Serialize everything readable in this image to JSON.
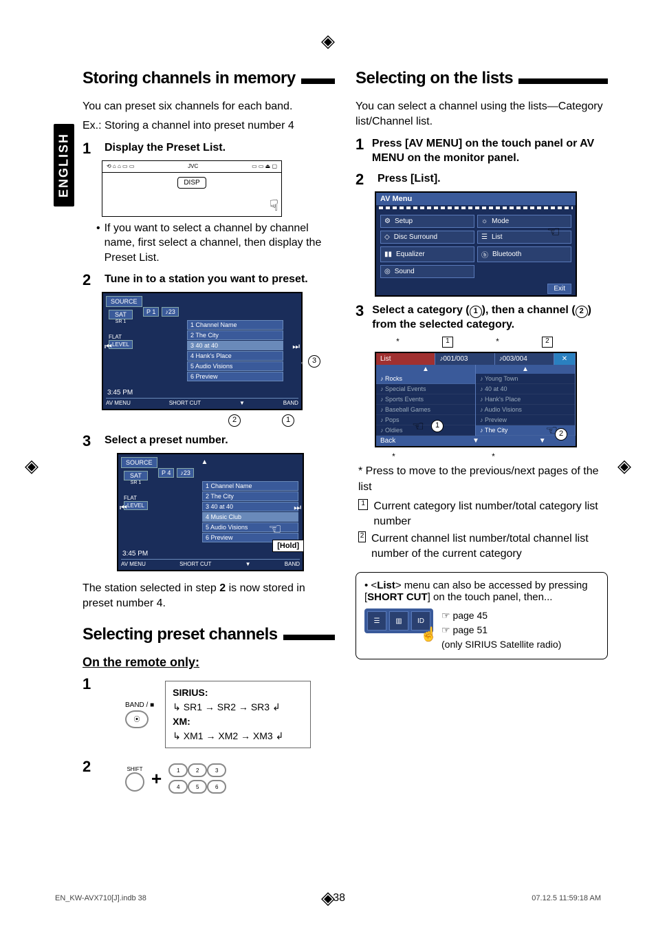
{
  "side_label": "ENGLISH",
  "page_number": "38",
  "footer_left": "EN_KW-AVX710[J].indb   38",
  "footer_right": "07.12.5   11:59:18 AM",
  "left": {
    "section1_title": "Storing channels in memory",
    "intro1": "You can preset six channels for each band.",
    "intro2": "Ex.: Storing a channel into preset number 4",
    "step1_num": "1",
    "step1_text": "Display the Preset List.",
    "disp_label": "DISP",
    "topstrip_brand": "JVC",
    "bullet1": "If you want to select a channel by channel name, first select a channel, then display the Preset List.",
    "step2_num": "2",
    "step2_text": "Tune in to a station you want to preset.",
    "screen_source": "SOURCE",
    "screen_sat": "SAT",
    "screen_sr": "SR 1",
    "screen_p1": "P 1",
    "screen_ch": "23",
    "screen_flat": "FLAT",
    "screen_level": "LEVEL",
    "plist": [
      "1 Channel Name",
      "2 The City",
      "3 40 at 40",
      "4 Hank's Place",
      "5 Audio Visions",
      "6 Preview"
    ],
    "screen_time": "3:45 PM",
    "screen_btm_left": "AV MENU",
    "screen_btm_short": "SHORT CUT",
    "screen_btm_right": "BAND",
    "step3_num": "3",
    "step3_text": "Select a preset number.",
    "screen2_p": "P 4",
    "plist2": [
      "1 Channel Name",
      "2 The City",
      "3 40 at 40",
      "4 Music Club",
      "5 Audio Visions",
      "6 Preview"
    ],
    "hold_label": "[Hold]",
    "after_text_a": "The station selected in step ",
    "after_text_b": " is now stored in preset number 4.",
    "after_step_ref": "2",
    "section2_title": "Selecting preset channels",
    "subtitle": "On the remote only:",
    "remote_step1": "1",
    "remote_step2": "2",
    "band_label": "BAND / ",
    "sirius_line": "SIRIUS:",
    "sirius_seq": "SR1 → SR2 → SR3",
    "xm_line": "XM:",
    "xm_seq": "XM1 → XM2 → XM3",
    "shift_label": "SHIFT"
  },
  "right": {
    "section_title": "Selecting on the lists",
    "intro": "You can select a channel using the lists—Category list/Channel list.",
    "step1_num": "1",
    "step1_text": "Press [AV MENU] on the touch panel or AV MENU on the monitor panel.",
    "step2_num": "2",
    "step2_text": "Press [List].",
    "avmenu_title": "AV Menu",
    "menu_items_left": [
      "Setup",
      "Disc Surround",
      "Equalizer",
      "Sound"
    ],
    "menu_items_right": [
      "Mode",
      "List",
      "Bluetooth"
    ],
    "exit_label": "Exit",
    "step3_num": "3",
    "step3_text_a": "Select a category (",
    "step3_text_b": "), then a channel (",
    "step3_text_c": ") from the selected category.",
    "circ1": "1",
    "circ2": "2",
    "list_label": "List",
    "list_count1": "001/003",
    "list_count2": "003/004",
    "cats": [
      "Rocks",
      "Special Events",
      "Sports Events",
      "Baseball Games",
      "Pops",
      "Oldies"
    ],
    "chs": [
      "Young Town",
      "40 at 40",
      "Hank's Place",
      "Audio Visions",
      "Preview",
      "The City"
    ],
    "back_label": "Back",
    "ast_line": "* Press to move to the previous/next pages of the list",
    "sq1_text": "Current category list number/total category list number",
    "sq2_text": "Current channel list number/total channel list number of the current category",
    "note_line_a": "<",
    "note_list": "List",
    "note_line_b": "> menu can also be accessed by pressing [",
    "note_short": "SHORT CUT",
    "note_line_c": "] on the touch panel, then...",
    "ref1": "☞ page 45",
    "ref2": "☞ page 51",
    "ref3": "(only SIRIUS Satellite radio)",
    "icon_id": "ID"
  }
}
